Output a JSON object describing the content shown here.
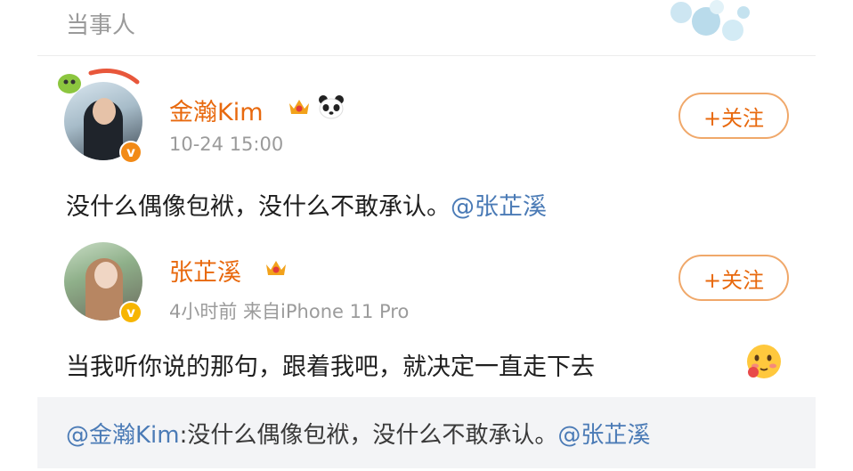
{
  "header": {
    "label": "当事人"
  },
  "posts": [
    {
      "username": "金瀚Kim",
      "timestamp": "10-24 15:00",
      "follow_label": "+关注",
      "text": "没什么偶像包袱，没什么不敢承认。",
      "mention": "@张芷溪"
    },
    {
      "username": "张芷溪",
      "meta": "4小时前  来自iPhone 11 Pro",
      "follow_label": "+关注",
      "text": "当我听你说的那句，跟着我吧，就决定一直走下去"
    }
  ],
  "quote": {
    "author": "@金瀚Kim",
    "text": ":没什么偶像包袱，没什么不敢承认。",
    "mention": "@张芷溪"
  },
  "colors": {
    "username": "#e8690e",
    "mention": "#4b7bb6",
    "meta": "#9b9b9b",
    "quote_bg": "#f3f4f6"
  },
  "icons": [
    "verified-badge-icon",
    "crown-level-icon",
    "panda-icon",
    "blushing-emoji-icon"
  ]
}
